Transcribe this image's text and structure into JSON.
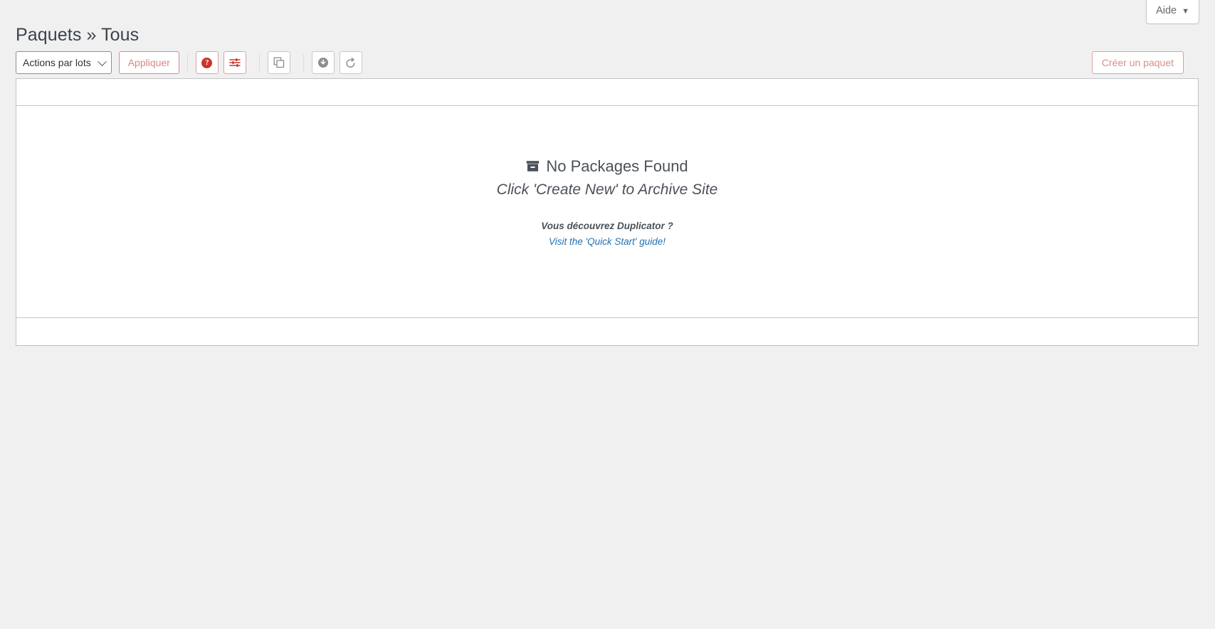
{
  "page": {
    "title": "Paquets » Tous"
  },
  "help_tab": {
    "label": "Aide",
    "caret": "▼"
  },
  "toolbar": {
    "bulk_actions": {
      "selected": "Actions par lots",
      "options": [
        "Actions par lots"
      ]
    },
    "apply_label": "Appliquer",
    "icon_buttons": [
      {
        "name": "help-icon",
        "glyph": "?",
        "style": "red",
        "title": "Aide"
      },
      {
        "name": "sliders-icon",
        "glyph": "",
        "style": "red",
        "title": "Options"
      },
      {
        "name": "copy-icon",
        "glyph": "",
        "style": "gray",
        "title": "Copier"
      },
      {
        "name": "download-icon",
        "glyph": "",
        "style": "gray",
        "title": "Télécharger"
      },
      {
        "name": "restore-icon",
        "glyph": "",
        "style": "gray",
        "title": "Restaurer"
      }
    ],
    "create_package_label": "Créer un paquet"
  },
  "table": {
    "columns": [],
    "rows": [],
    "empty_state": {
      "icon": "archive-box-icon",
      "title": "No Packages Found",
      "subtitle": "Click 'Create New' to Archive Site",
      "promo_text": "Vous découvrez Duplicator ?",
      "promo_link": "Visit the 'Quick Start' guide!"
    }
  },
  "colors": {
    "page_background": "#f0f0f1",
    "surface": "#ffffff",
    "accent_red": "#d98a85",
    "icon_red": "#c9342b",
    "link_blue": "#2271b1",
    "text": "#3c434a",
    "border": "#c3c4c7"
  }
}
